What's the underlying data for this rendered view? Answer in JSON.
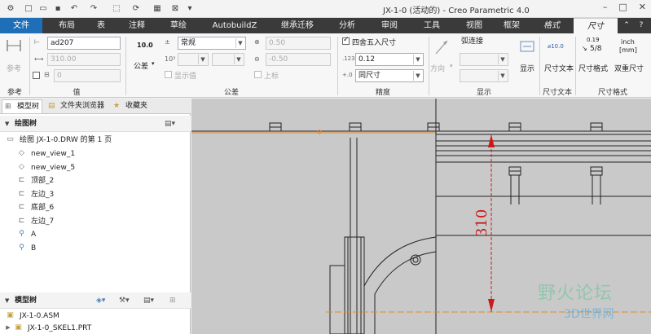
{
  "window": {
    "title": "JX-1-0 (活动的) - Creo Parametric 4.0"
  },
  "quick_access": [
    {
      "name": "new-icon",
      "glyph": "□"
    },
    {
      "name": "open-icon",
      "glyph": "▭"
    },
    {
      "name": "save-icon",
      "glyph": "▪"
    },
    {
      "name": "undo-icon",
      "glyph": "↶"
    },
    {
      "name": "redo-icon",
      "glyph": "↷"
    },
    {
      "name": "select-box-icon",
      "glyph": "⬚"
    },
    {
      "name": "regenerate-icon",
      "glyph": "⟳"
    },
    {
      "name": "window-icon",
      "glyph": "▦"
    },
    {
      "name": "close-window-icon",
      "glyph": "⊠"
    }
  ],
  "tabs": [
    "文件",
    "布局",
    "表",
    "注释",
    "草绘",
    "AutobuildZ",
    "继承迁移",
    "分析",
    "审阅",
    "工具",
    "视图",
    "框架",
    "格式",
    "尺寸"
  ],
  "active_tab": "尺寸",
  "ribbon": {
    "reference": {
      "label": "参考",
      "group": "参考"
    },
    "value": {
      "group": "值",
      "name_field": "ad207",
      "value_field": "310.00",
      "override_field": "0"
    },
    "tolerance": {
      "group": "公差",
      "format_label": "10.0",
      "tolerance_button": "公差",
      "mode": "常规",
      "upper": "0.50",
      "lower": "-0.50",
      "show_value": "显示值",
      "superscript": "上标"
    },
    "precision": {
      "group": "精度",
      "round_label": "四舍五入尺寸",
      "decimals": "0.12",
      "same_as": "同尺寸"
    },
    "display": {
      "group": "显示",
      "arc_label": "弧连接",
      "direction_label": "方向",
      "show_label": "显示"
    },
    "dim_text": {
      "group": "尺寸文本",
      "label": "尺寸文本",
      "icon_text": "⌀10.0"
    },
    "dim_format": {
      "group": "尺寸格式",
      "format_label": "尺寸格式",
      "dual_label": "双重尺寸",
      "frac_top": "0.19",
      "frac_val": "5/8",
      "dual_top": "inch",
      "dual_bottom": "[mm]"
    }
  },
  "left_pane": {
    "tabs": [
      "模型树",
      "文件夹浏览器",
      "收藏夹"
    ],
    "drawing_tree": {
      "header": "绘图树",
      "root": "绘图 JX-1-0.DRW 的第 1 页",
      "items": [
        {
          "label": "new_view_1",
          "icon": "view-icon"
        },
        {
          "label": "new_view_5",
          "icon": "view-icon"
        },
        {
          "label": "顶部_2",
          "icon": "proj-view-icon"
        },
        {
          "label": "左边_3",
          "icon": "proj-view-icon"
        },
        {
          "label": "底部_6",
          "icon": "proj-view-icon"
        },
        {
          "label": "左边_7",
          "icon": "proj-view-icon"
        },
        {
          "label": "A",
          "icon": "section-icon"
        },
        {
          "label": "B",
          "icon": "section-icon"
        }
      ]
    },
    "model_tree": {
      "header": "模型树",
      "items": [
        "JX-1-0.ASM",
        "JX-1-0_SKEL1.PRT"
      ]
    }
  },
  "canvas": {
    "dimension_value": "310"
  },
  "watermark": {
    "text": "野火论坛",
    "sub": "3D世界网"
  },
  "colors": {
    "file_tab": "#1f6fb8",
    "dimension": "#cc1a1a",
    "orange_axis": "#e08a2a",
    "canvas_bg": "#c9c9c9"
  }
}
